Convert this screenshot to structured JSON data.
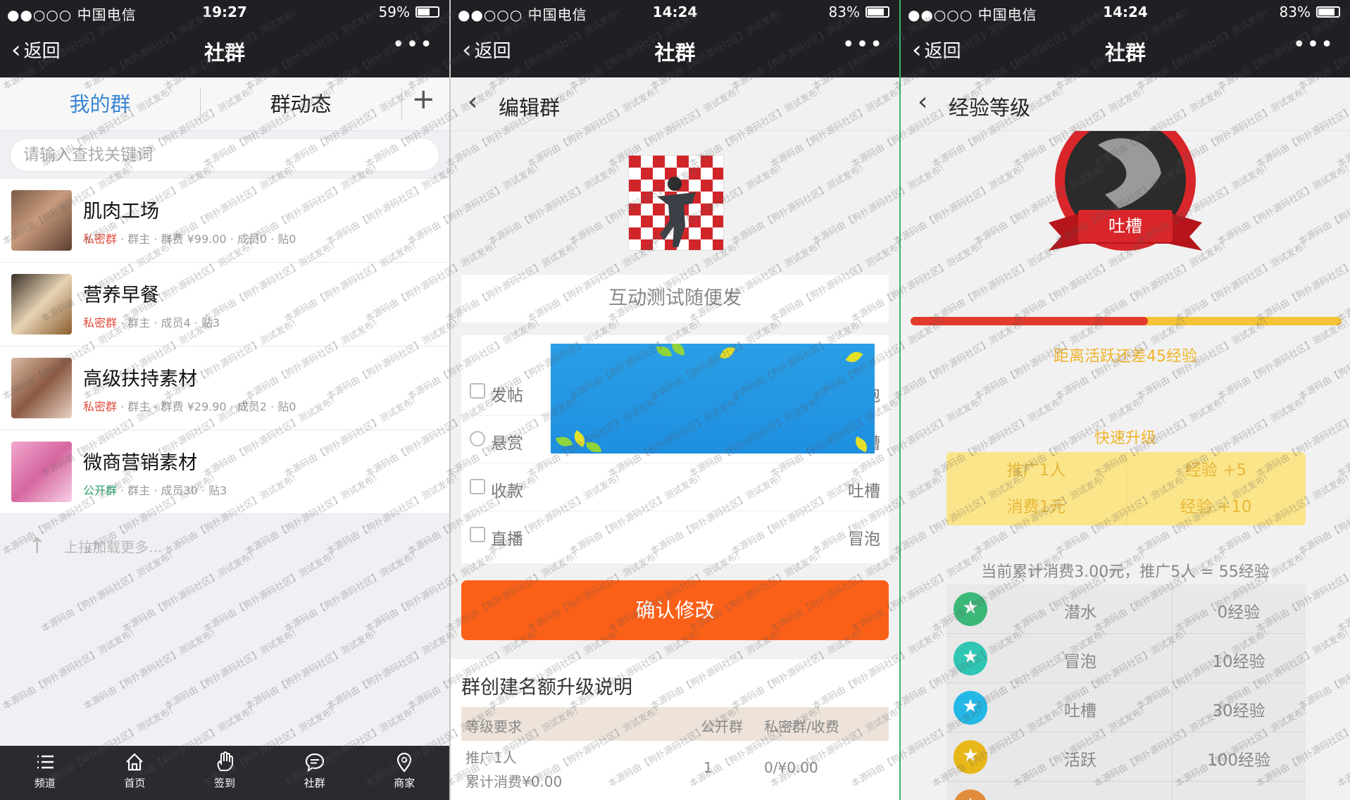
{
  "colors": {
    "accent_blue": "#3a86d4",
    "private_red": "#e24a3b",
    "public_green": "#2aa36b",
    "confirm_orange": "#fb6018",
    "gold": "#f0b429",
    "progress_red": "#e23a2c",
    "nav_dark": "#1f2024"
  },
  "screens": [
    {
      "status": {
        "carrier": "●●○○○ 中国电信",
        "time": "19:27",
        "battery": "59%",
        "battery_level": 0.59
      },
      "nav": {
        "back": "返回",
        "title": "社群",
        "more": "•••"
      },
      "tabs": [
        {
          "label": "我的群"
        },
        {
          "label": "群动态"
        }
      ],
      "search_placeholder": "请输入查找关键词",
      "groups": [
        {
          "name": "肌肉工场",
          "type": "私密群",
          "meta": " · 群主 · 群费 ¥99.00 · 成员0 · 贴0"
        },
        {
          "name": "营养早餐",
          "type": "私密群",
          "meta": " · 群主 · 成员4 · 贴3"
        },
        {
          "name": "高级扶持素材",
          "type": "私密群",
          "meta": " · 群主 · 群费 ¥29.90 · 成员2 · 贴0"
        },
        {
          "name": "微商营销素材",
          "type": "公开群",
          "meta": " · 群主 · 成员30 · 贴3"
        }
      ],
      "load_more": "上拉加载更多...",
      "tabbar": [
        {
          "label": "频道",
          "icon": "list-icon"
        },
        {
          "label": "首页",
          "icon": "home-icon"
        },
        {
          "label": "签到",
          "icon": "hand-icon"
        },
        {
          "label": "社群",
          "icon": "chat-icon"
        },
        {
          "label": "商家",
          "icon": "location-icon"
        }
      ]
    },
    {
      "status": {
        "carrier": "●●○○○ 中国电信",
        "time": "14:24",
        "battery": "83%",
        "battery_level": 0.83
      },
      "nav": {
        "back": "返回",
        "title": "社群",
        "more": "•••"
      },
      "subheader": "编辑群",
      "group_name": "互动测试随便发",
      "permissions": [
        {
          "label": "发帖",
          "value": "冒泡"
        },
        {
          "label": "悬赏",
          "value": "吐槽"
        },
        {
          "label": "收款",
          "value": "吐槽"
        },
        {
          "label": "直播",
          "value": "冒泡"
        }
      ],
      "confirm_button": "确认修改",
      "info_title": "群创建名额升级说明",
      "table_headers": {
        "req": "等级要求",
        "public": "公开群",
        "private": "私密群/收费"
      },
      "table_rows": [
        {
          "req1": "推广1人",
          "req2": "累计消费¥0.00",
          "public": "1",
          "private": "0/¥0.00"
        }
      ]
    },
    {
      "status": {
        "carrier": "●●○○○ 中国电信",
        "time": "14:24",
        "battery": "83%",
        "battery_level": 0.83
      },
      "nav": {
        "back": "返回",
        "title": "社群",
        "more": "•••"
      },
      "subheader": "经验等级",
      "badge_label": "吐槽",
      "progress": 0.55,
      "distance_text": "距离活跃还差45经验",
      "quick_title": "快速升级",
      "quick_rows": [
        {
          "left": "推广1人",
          "right": "经验 +5"
        },
        {
          "left": "消费1元",
          "right": "经验 +10"
        }
      ],
      "summary": "当前累计消费3.00元，推广5人 = 55经验",
      "levels": [
        {
          "code": "V1",
          "name": "潜水",
          "exp": "0经验",
          "color": "#3cb878"
        },
        {
          "code": "V2",
          "name": "冒泡",
          "exp": "10经验",
          "color": "#2fc6b4"
        },
        {
          "code": "V3",
          "name": "吐槽",
          "exp": "30经验",
          "color": "#23b8e6"
        },
        {
          "code": "V4",
          "name": "活跃",
          "exp": "100经验",
          "color": "#e8b81a"
        },
        {
          "code": "V5",
          "name": "",
          "exp": "",
          "color": "#e08c3a"
        }
      ]
    }
  ],
  "watermark": "本源码由【狗扑源码社区】测试发布!"
}
